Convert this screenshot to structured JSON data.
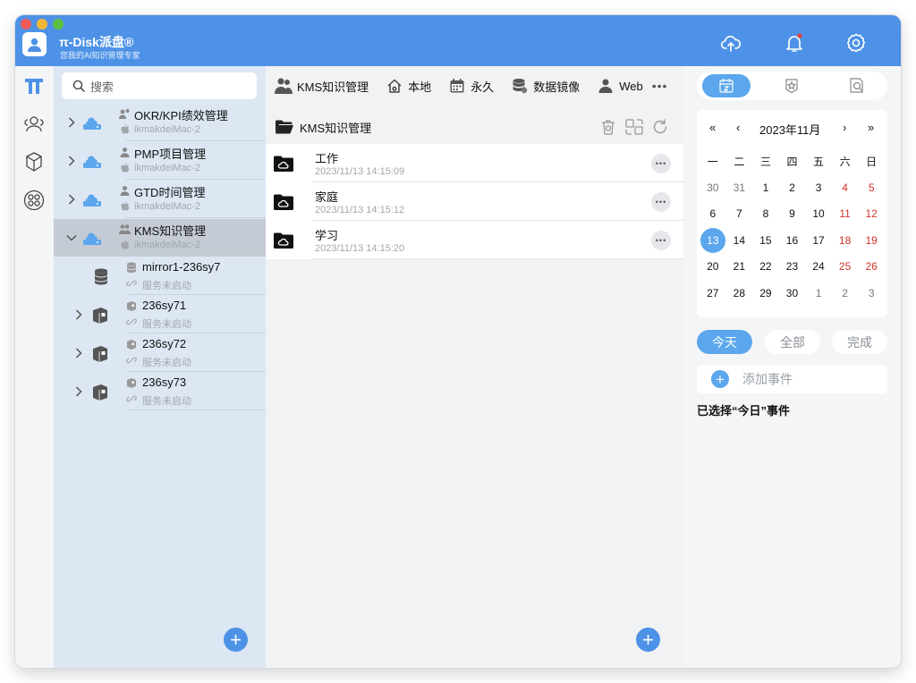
{
  "app": {
    "name": "π-Disk派盘®",
    "subtitle": "您我的AI知识管理专家"
  },
  "titlebar": {
    "icons": [
      "cloud-upload-icon",
      "bell-icon",
      "gear-icon"
    ],
    "notification_dot_color": "#e5403a"
  },
  "colors": {
    "accent": "#4d92e6",
    "accent_light": "#5ba6ec",
    "weekend": "#d0342c",
    "selected_row": "#c4cbd4",
    "tree_bg": "#dce7f3"
  },
  "rail": {
    "items": [
      "pi-logo-icon",
      "people-group-icon",
      "box-icon",
      "apps-grid-icon"
    ]
  },
  "search": {
    "placeholder": "搜索"
  },
  "tree": {
    "nodes": [
      {
        "title": "OKR/KPI绩效管理",
        "sub": "ikmakdeiMac-2",
        "selected": false
      },
      {
        "title": "PMP项目管理",
        "sub": "ikmakdeiMac-2",
        "selected": false
      },
      {
        "title": "GTD时间管理",
        "sub": "ikmakdeiMac-2",
        "selected": false
      },
      {
        "title": "KMS知识管理",
        "sub": "ikmakdeiMac-2",
        "selected": true
      }
    ],
    "children": [
      {
        "title": "mirror1-236sy7",
        "sub": "服务未启动"
      },
      {
        "title": "236sy71",
        "sub": "服务未启动"
      },
      {
        "title": "236sy72",
        "sub": "服务未启动"
      },
      {
        "title": "236sy73",
        "sub": "服务未启动"
      }
    ]
  },
  "tabs": [
    {
      "label": "KMS知识管理",
      "icon": "kms-people-icon"
    },
    {
      "label": "本地",
      "icon": "home-icon"
    },
    {
      "label": "永久",
      "icon": "calendar-icon"
    },
    {
      "label": "数据镜像",
      "icon": "database-icon"
    },
    {
      "label": "Web",
      "icon": "web-user-icon"
    }
  ],
  "tabs_more": "•••",
  "folder": {
    "title": "KMS知识管理",
    "tools": [
      "trash-icon",
      "copy-icon",
      "refresh-icon"
    ]
  },
  "files": [
    {
      "name": "工作",
      "date": "2023/11/13 14:15:09"
    },
    {
      "name": "家庭",
      "date": "2023/11/13 14:15:12"
    },
    {
      "name": "学习",
      "date": "2023/11/13 14:15:20"
    }
  ],
  "file_more": "•••",
  "calendar": {
    "prev_year": "«",
    "prev_month": "‹",
    "title": "2023年11月",
    "next_month": "›",
    "next_year": "»",
    "weekdays": [
      "一",
      "二",
      "三",
      "四",
      "五",
      "六",
      "日"
    ],
    "weeks": [
      [
        "30",
        "31",
        "1",
        "2",
        "3",
        "4",
        "5"
      ],
      [
        "6",
        "7",
        "8",
        "9",
        "10",
        "11",
        "12"
      ],
      [
        "13",
        "14",
        "15",
        "16",
        "17",
        "18",
        "19"
      ],
      [
        "20",
        "21",
        "22",
        "23",
        "24",
        "25",
        "26"
      ],
      [
        "27",
        "28",
        "29",
        "30",
        "1",
        "2",
        "3"
      ]
    ],
    "today": "13"
  },
  "filters": [
    {
      "label": "今天",
      "active": true
    },
    {
      "label": "全部",
      "active": false
    },
    {
      "label": "完成",
      "active": false
    }
  ],
  "add_event": "添加事件",
  "selected_note": "已选择“今日”事件"
}
